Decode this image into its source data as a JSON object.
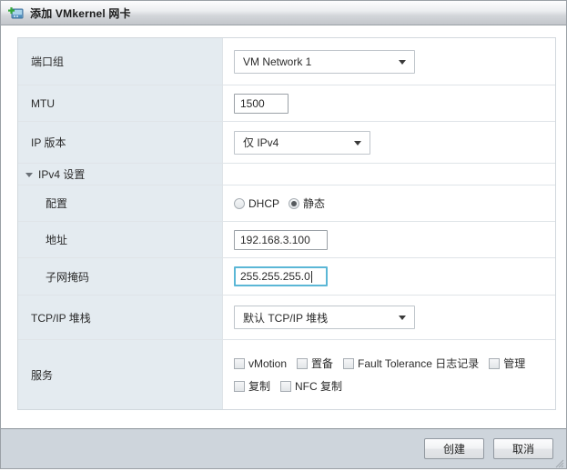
{
  "window": {
    "title": "添加 VMkernel 网卡",
    "icon": "add-vmkernel-nic-icon"
  },
  "form": {
    "rows": {
      "port_group": {
        "label": "端口组",
        "value": "VM Network 1"
      },
      "mtu": {
        "label": "MTU",
        "value": "1500"
      },
      "ip_version": {
        "label": "IP 版本",
        "value": "仅 IPv4"
      },
      "ipv4_section": {
        "label": "IPv4 设置"
      },
      "configuration": {
        "label": "配置",
        "options": [
          {
            "label": "DHCP",
            "checked": false
          },
          {
            "label": "静态",
            "checked": true
          }
        ]
      },
      "address": {
        "label": "地址",
        "value": "192.168.3.100"
      },
      "subnet_mask": {
        "label": "子网掩码",
        "value": "255.255.255.0",
        "focused": true
      },
      "tcpip_stack": {
        "label": "TCP/IP 堆栈",
        "value": "默认 TCP/IP 堆栈"
      },
      "services": {
        "label": "服务",
        "line1": [
          {
            "label": "vMotion",
            "checked": false
          },
          {
            "label": "置备",
            "checked": false
          },
          {
            "label": "Fault Tolerance 日志记录",
            "checked": false
          },
          {
            "label": "管理",
            "checked": false
          }
        ],
        "line2": [
          {
            "label": "复制",
            "checked": false
          },
          {
            "label": "NFC 复制",
            "checked": false
          }
        ]
      }
    }
  },
  "footer": {
    "create_label": "创建",
    "cancel_label": "取消"
  },
  "colors": {
    "label_column_bg": "#e4ebf0",
    "focus_border": "#5bb7d6",
    "footer_bg": "#ced5dc",
    "titlebar_border": "#9aa0a6"
  }
}
